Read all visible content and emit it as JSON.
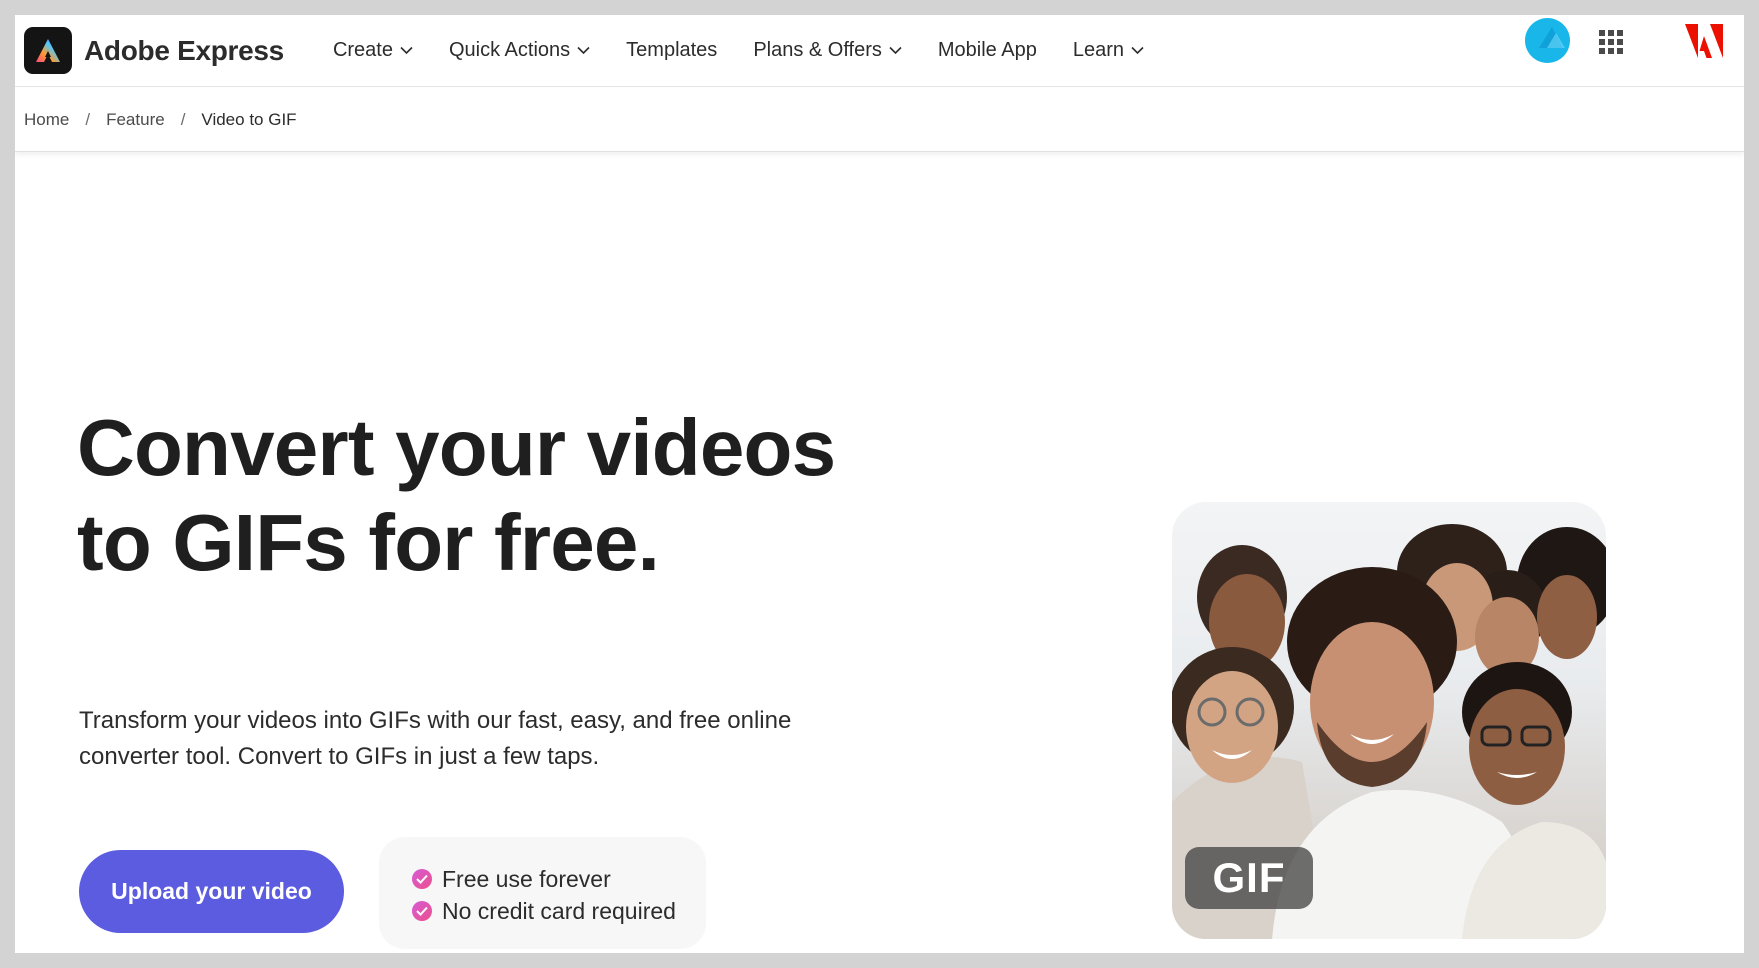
{
  "brand": {
    "name": "Adobe Express"
  },
  "nav": {
    "items": [
      {
        "label": "Create",
        "dropdown": true
      },
      {
        "label": "Quick Actions",
        "dropdown": true
      },
      {
        "label": "Templates",
        "dropdown": false
      },
      {
        "label": "Plans & Offers",
        "dropdown": true
      },
      {
        "label": "Mobile App",
        "dropdown": false
      },
      {
        "label": "Learn",
        "dropdown": true
      }
    ]
  },
  "breadcrumb": {
    "items": [
      "Home",
      "Feature",
      "Video to GIF"
    ],
    "separator": "/"
  },
  "hero": {
    "title": "Convert your videos to GIFs for free.",
    "subtitle": "Transform your videos into GIFs with our fast, easy, and free online converter tool. Convert to GIFs in just a few taps.",
    "cta_label": "Upload your video",
    "benefits": [
      "Free use forever",
      "No credit card required"
    ]
  },
  "media": {
    "badge": "GIF"
  },
  "colors": {
    "accent": "#5c5ce0",
    "adobe_red": "#eb1000",
    "avatar": "#19b7e9",
    "check_gradient_start": "#d65bd8",
    "check_gradient_end": "#ec4f8a"
  },
  "icons": {
    "logo": "adobe-express-logo-icon",
    "chevron": "chevron-down-icon",
    "apps": "app-grid-icon",
    "adobe": "adobe-logo-icon",
    "check": "checkmark-circle-icon"
  }
}
